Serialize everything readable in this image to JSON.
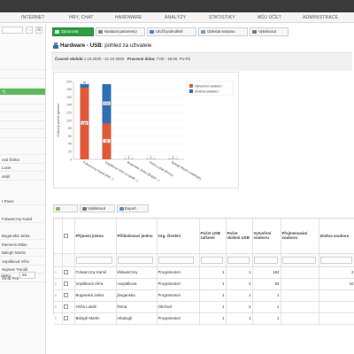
{
  "topnav": {
    "items": [
      "INTERNET",
      "HRY, CHAT",
      "HARDWARE",
      "ANALÝZY",
      "STATISTIKY",
      "MŮJ ÚČET",
      "ADMINISTRACE"
    ]
  },
  "sidebar": {
    "rows": [
      "T]",
      "",
      "",
      "",
      "",
      "",
      "",
      "ová Šárka",
      "Lucie",
      "ukáš",
      "",
      "",
      "t Pavel"
    ],
    "folwarczny": "Folwarczny Kamil",
    "bottom_rows": [
      "Buganská Jarka",
      "Klemens Milan",
      "Balogh Martin",
      "Vopálková Věra",
      "Najman Tomáš",
      "Šmíd Petr"
    ],
    "page_size_label": "ránky:",
    "page_size_value": "26",
    "arrow_btn": "↑↓",
    "filter_btn": "⊞"
  },
  "toolbar": {
    "buttons": [
      "Zpracovat",
      "Nastavit parametry",
      "Uložit jednotlivě",
      "Odeslat sestavu",
      "Vytisknout"
    ]
  },
  "page": {
    "title_bold": "Hardware - USB",
    "title_rest": ": pohled za uživatele",
    "period_label": "Časové období",
    "period_value": "1.10.2020 - 31.10.2020",
    "hours_label": "Pracovní doba:",
    "hours_value": "7:00 - 18:00, Po-Pá"
  },
  "chart_data": {
    "type": "bar",
    "stacked": true,
    "ylabel": "Celkový počet operací",
    "ylim": [
      0,
      200
    ],
    "yticks": [
      0,
      20,
      40,
      60,
      80,
      100,
      120,
      140,
      160,
      180,
      200
    ],
    "categories": [
      "Folwarczny Kamil (kfol...)",
      "Vopálková Věra (vvopalk...)",
      "Buganská Jarka (jbugan...)",
      "Hriňa Lukáš (lhrina)",
      "Balogh Martin (mbalogh)"
    ],
    "series": [
      {
        "name": "Vytvoření souboru",
        "color": "#e05a3a",
        "values": [
          184,
          92,
          1,
          1,
          1
        ]
      },
      {
        "name": "Změna souboru",
        "color": "#2f6fb2",
        "values": [
          10,
          101,
          0,
          0,
          0
        ]
      }
    ],
    "data_labels": [
      [
        "184",
        "92",
        "1",
        "1",
        "1"
      ],
      [
        "10",
        "101",
        "",
        "",
        ""
      ]
    ],
    "legend_position": "top-right"
  },
  "grid_toolbar": {
    "buttons": [
      "",
      "Vytisknout",
      "Export"
    ]
  },
  "grid": {
    "columns": [
      "",
      "",
      "Příjmení jméno",
      "Přihlašovací jméno",
      "Org. členění",
      "Počet USB zařízení",
      "Počet vložení USB",
      "Vytvoření souboru",
      "Přejmenování souboru",
      "Změna souboru"
    ],
    "rows": [
      {
        "name": "Folwarczny Kamil",
        "login": "kfolwarczny",
        "org": "Programatori",
        "devices": "1",
        "inserts": "1",
        "created": "184",
        "renamed": "",
        "changed": "2"
      },
      {
        "name": "Vopálková Věra",
        "login": "vvopalkova",
        "org": "Programatori",
        "devices": "1",
        "inserts": "3",
        "created": "92",
        "renamed": "",
        "changed": "10"
      },
      {
        "name": "Buganská Jarka",
        "login": "jbuganska",
        "org": "Programatori",
        "devices": "1",
        "inserts": "1",
        "created": "1",
        "renamed": "",
        "changed": ""
      },
      {
        "name": "Hriňa Lukáš",
        "login": "lhrina",
        "org": "Obchod",
        "devices": "1",
        "inserts": "2",
        "created": "1",
        "renamed": "",
        "changed": ""
      },
      {
        "name": "Balogh Martin",
        "login": "mbalogh",
        "org": "Programatori",
        "devices": "1",
        "inserts": "1",
        "created": "1",
        "renamed": "",
        "changed": ""
      }
    ]
  }
}
